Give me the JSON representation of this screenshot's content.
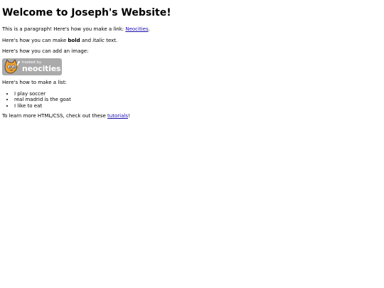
{
  "page": {
    "heading": "Welcome to Joseph's Website!",
    "para1_text": "This is a paragraph! Here's how you make a link: ",
    "para1_link": "Neocities",
    "para1_end": ".",
    "para2_start": "Here's how you can make ",
    "para2_bold": "bold",
    "para2_mid": " and ",
    "para2_italic": "italic",
    "para2_end": " text.",
    "para3": "Here's how you can add an image:",
    "badge": {
      "line1": "hosted by",
      "line2": "neocities",
      "icon": "cat-mascot-icon"
    },
    "para4": "Here's how to make a list:",
    "list": [
      "I play soccer",
      "real madrid is the goat",
      "I like to eat"
    ],
    "para5_start": "To learn more HTML/CSS, check out these ",
    "para5_link": "tutorials",
    "para5_end": "!"
  },
  "colors": {
    "link": "#1a0dab",
    "badge_bg": "#aaaaaa",
    "cat_fill": "#f0a030"
  }
}
